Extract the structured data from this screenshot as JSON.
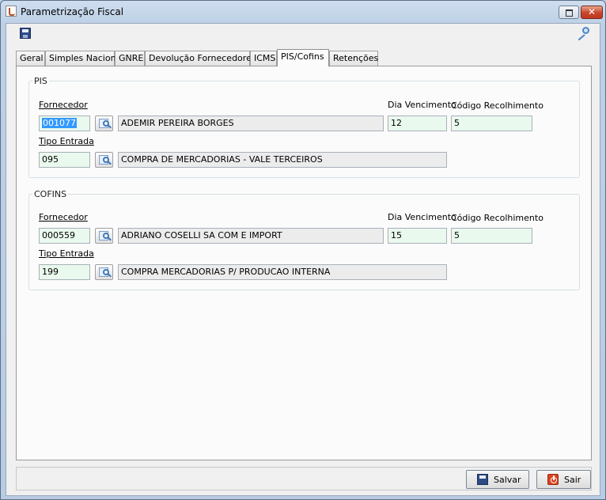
{
  "window": {
    "title": "Parametrização Fiscal"
  },
  "toolbar": {
    "save_icon": "save-icon",
    "key_icon": "key-icon"
  },
  "tabs": [
    {
      "label": "Geral"
    },
    {
      "label": "Simples Nacional"
    },
    {
      "label": "GNRE"
    },
    {
      "label": "Devolução Fornecedores"
    },
    {
      "label": "ICMS"
    },
    {
      "label": "PIS/Cofins",
      "active": true
    },
    {
      "label": "Retenções"
    }
  ],
  "pis": {
    "legend": "PIS",
    "fornecedor_label": "Fornecedor",
    "fornecedor_code": "001077",
    "fornecedor_name": "ADEMIR PEREIRA BORGES",
    "dia_venc_label": "Dia Vencimento",
    "dia_venc": "12",
    "cod_recol_label": "Código Recolhimento",
    "cod_recol": "5",
    "tipo_label": "Tipo Entrada",
    "tipo_code": "095",
    "tipo_desc": "COMPRA DE MERCADORIAS - VALE TERCEIROS"
  },
  "cofins": {
    "legend": "COFINS",
    "fornecedor_label": "Fornecedor",
    "fornecedor_code": "000559",
    "fornecedor_name": "ADRIANO COSELLI SA COM E IMPORT",
    "dia_venc_label": "Dia Vencimento",
    "dia_venc": "15",
    "cod_recol_label": "Código Recolhimento",
    "cod_recol": "5",
    "tipo_label": "Tipo Entrada",
    "tipo_code": "199",
    "tipo_desc": "COMPRA MERCADORIAS P/ PRODUCAO INTERNA"
  },
  "buttons": {
    "save": "Salvar",
    "exit": "Sair"
  },
  "colors": {
    "field_green": "#eaf9ee",
    "selection": "#3399ff",
    "window_frame": "#bcd0e6"
  }
}
